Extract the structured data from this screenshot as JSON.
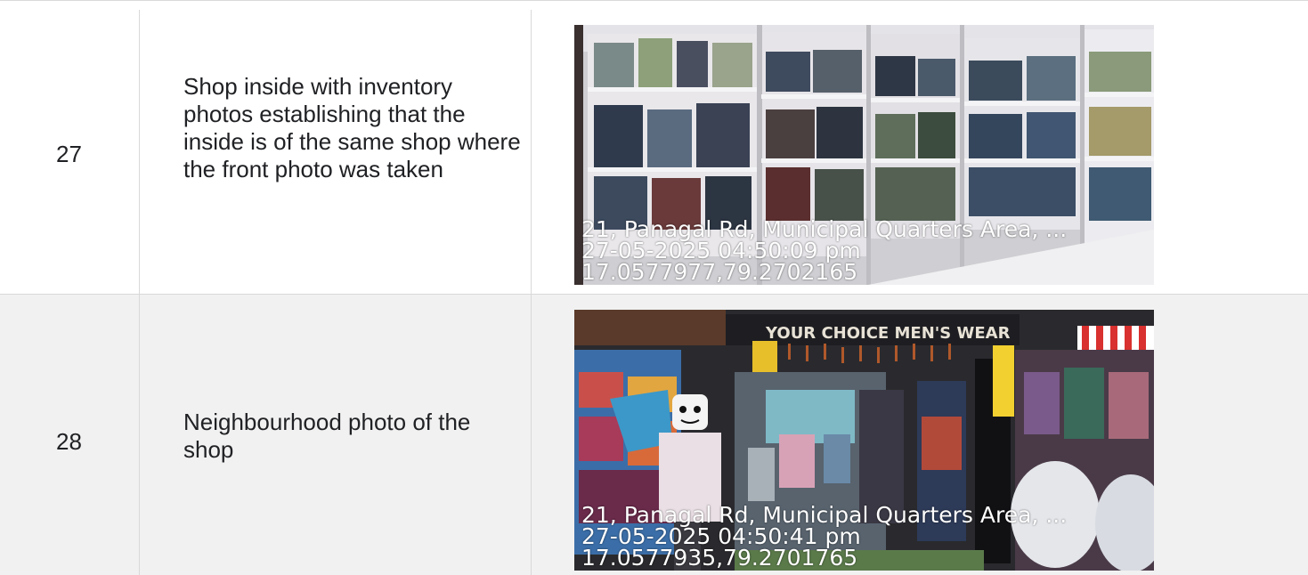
{
  "rows": [
    {
      "number": "27",
      "description": "Shop inside with inventory photos establishing that the inside is of the same shop where the front photo was taken",
      "photo_stamp": {
        "address": "21, Panagal Rd, Municipal Quarters Area, ...",
        "datetime": "27-05-2025 04:50:09 pm",
        "coords": "17.0577977,79.2702165"
      }
    },
    {
      "number": "28",
      "description": "Neighbourhood photo of the shop",
      "photo_stamp": {
        "address": "21, Panagal Rd, Municipal Quarters Area, ...",
        "datetime": "27-05-2025 04:50:41 pm",
        "coords": "17.0577935,79.2701765"
      }
    }
  ],
  "shop_sign": "YOUR CHOICE MEN'S WEAR"
}
